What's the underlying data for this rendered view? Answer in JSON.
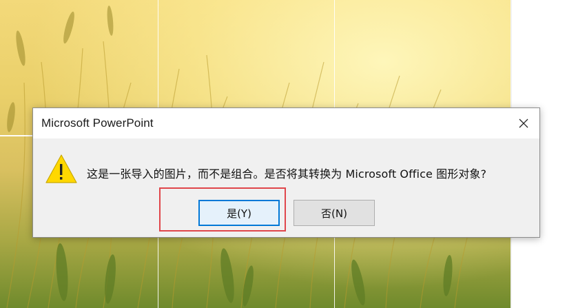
{
  "dialog": {
    "title": "Microsoft PowerPoint",
    "message": "这是一张导入的图片，而不是组合。是否将其转换为 Microsoft Office 图形对象?",
    "yes_label": "是(Y)",
    "no_label": "否(N)",
    "icons": {
      "warning": "warning-icon",
      "close": "close-icon"
    }
  },
  "colors": {
    "dialog_bg": "#f0f0f0",
    "titlebar_bg": "#ffffff",
    "default_button_border": "#0078d7",
    "highlight_box": "#e0454a",
    "warning_fill": "#ffd800"
  }
}
